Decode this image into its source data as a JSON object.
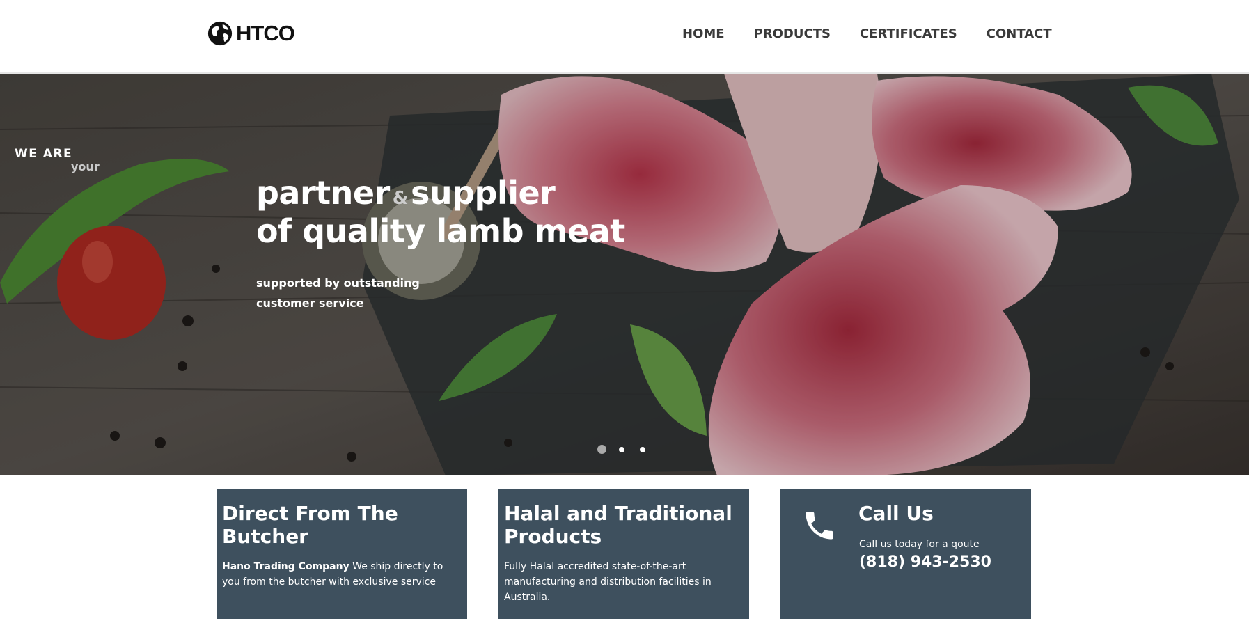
{
  "header": {
    "logo_text": "HTCO",
    "nav": [
      "HOME",
      "PRODUCTS",
      "CERTIFICATES",
      "CONTACT"
    ]
  },
  "hero": {
    "we_are": "WE ARE",
    "your": "your",
    "headline_1": "partner",
    "amp": "&",
    "headline_2": "supplier",
    "headline_3": "of quality lamb meat",
    "sub_1": "supported by outstanding",
    "sub_2": "customer service",
    "slides": 3,
    "active_slide": 1
  },
  "cards": [
    {
      "title": "Direct From The Butcher",
      "company": "Hano Trading Company",
      "text": " We ship directly to you from the butcher with exclusive service"
    },
    {
      "title": "Halal and Traditional Products",
      "text": "Fully Halal accredited state-of-the-art manufacturing and distribution facilities in Australia."
    },
    {
      "title": "Call Us",
      "subtitle": "Call us today for a qoute",
      "phone": "(818) 943-2530",
      "icon": "phone-icon"
    }
  ],
  "colors": {
    "card_bg": "#3e505e",
    "nav_text": "#3a3a3a"
  }
}
